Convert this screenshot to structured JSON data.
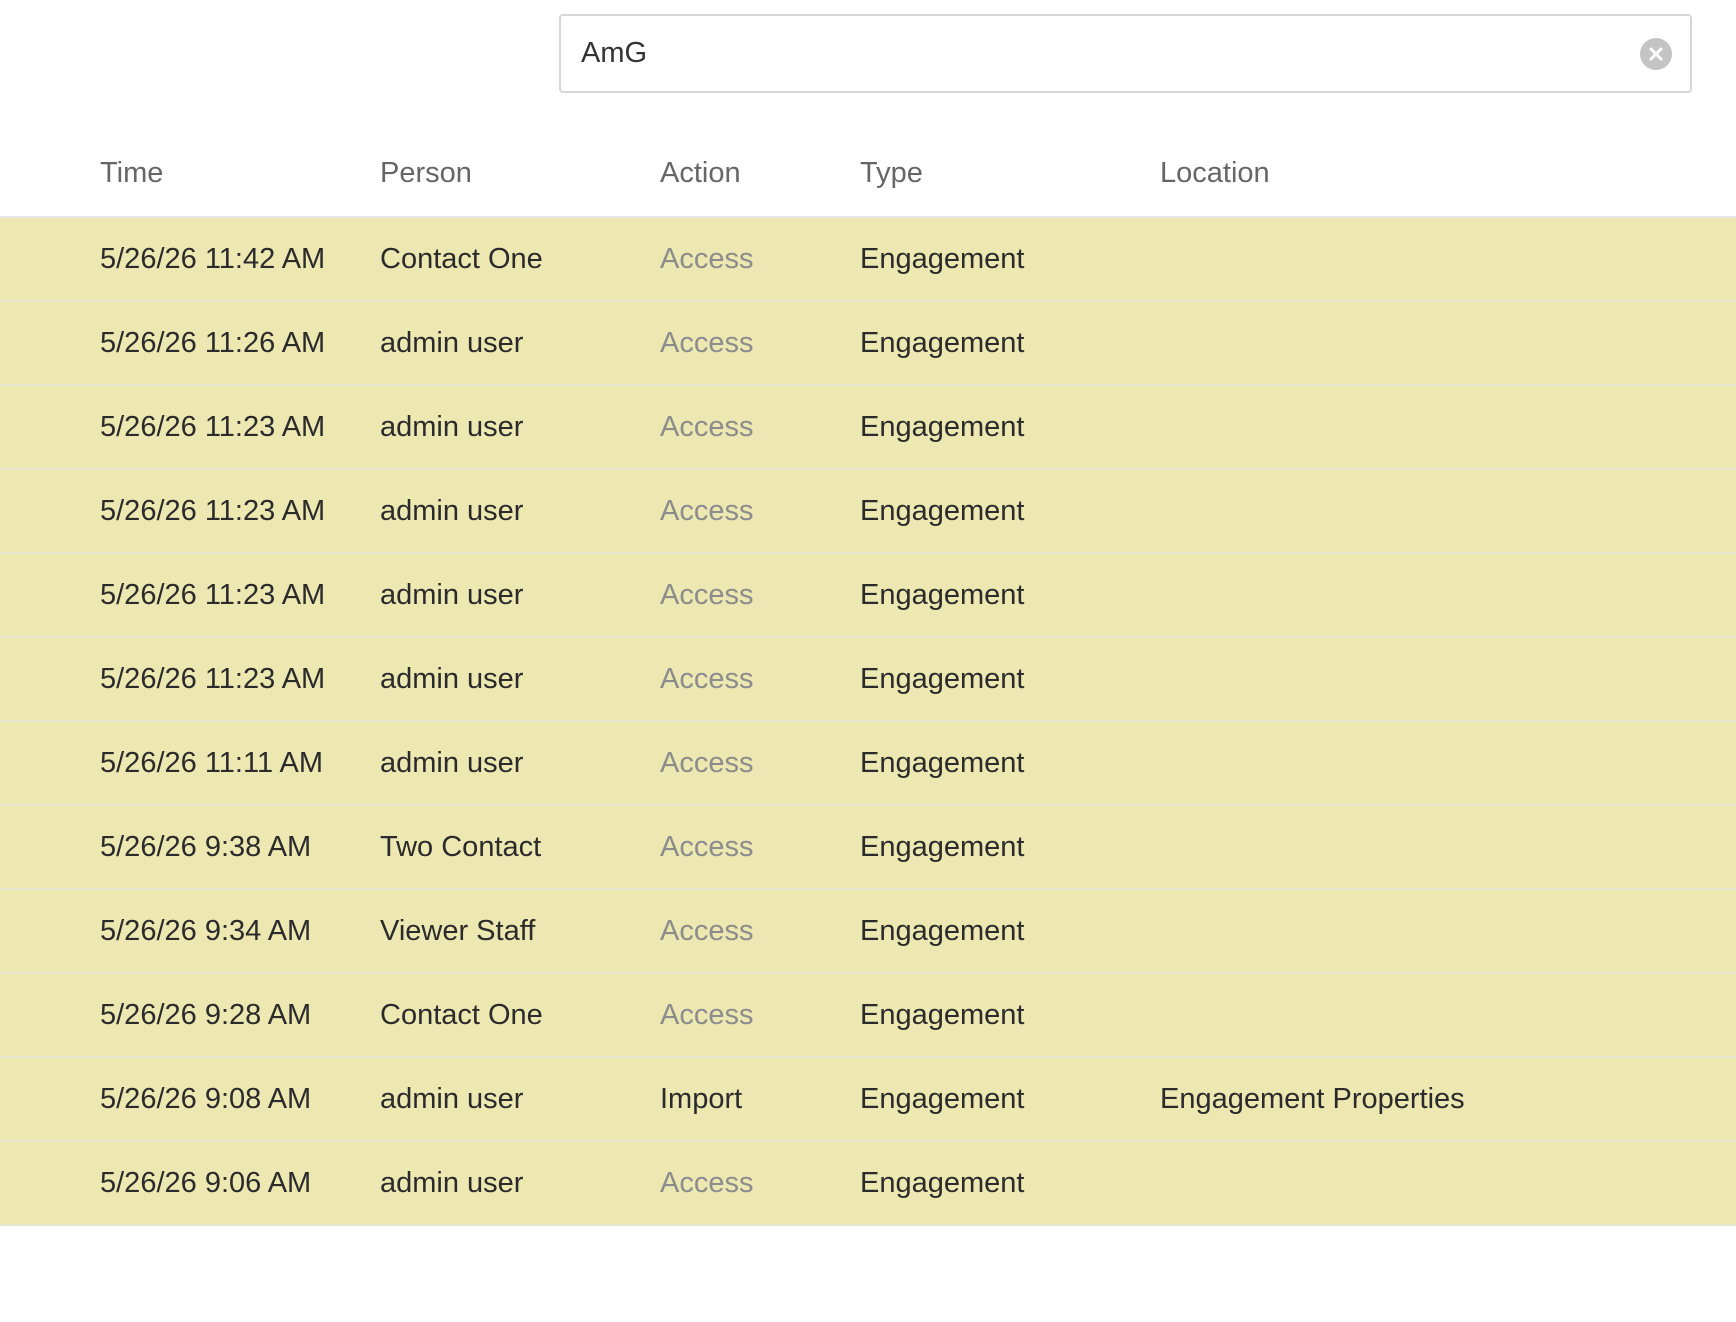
{
  "search": {
    "value": "AmG",
    "placeholder": ""
  },
  "table": {
    "headers": {
      "time": "Time",
      "person": "Person",
      "action": "Action",
      "type": "Type",
      "location": "Location"
    },
    "rows": [
      {
        "time": "5/26/26 11:42 AM",
        "person": "Contact One",
        "action": "Access",
        "type": "Engagement",
        "location": ""
      },
      {
        "time": "5/26/26 11:26 AM",
        "person": "admin user",
        "action": "Access",
        "type": "Engagement",
        "location": ""
      },
      {
        "time": "5/26/26 11:23 AM",
        "person": "admin user",
        "action": "Access",
        "type": "Engagement",
        "location": ""
      },
      {
        "time": "5/26/26 11:23 AM",
        "person": "admin user",
        "action": "Access",
        "type": "Engagement",
        "location": ""
      },
      {
        "time": "5/26/26 11:23 AM",
        "person": "admin user",
        "action": "Access",
        "type": "Engagement",
        "location": ""
      },
      {
        "time": "5/26/26 11:23 AM",
        "person": "admin user",
        "action": "Access",
        "type": "Engagement",
        "location": ""
      },
      {
        "time": "5/26/26 11:11 AM",
        "person": "admin user",
        "action": "Access",
        "type": "Engagement",
        "location": ""
      },
      {
        "time": "5/26/26 9:38 AM",
        "person": "Two Contact",
        "action": "Access",
        "type": "Engagement",
        "location": ""
      },
      {
        "time": "5/26/26 9:34 AM",
        "person": "Viewer Staff",
        "action": "Access",
        "type": "Engagement",
        "location": ""
      },
      {
        "time": "5/26/26 9:28 AM",
        "person": "Contact One",
        "action": "Access",
        "type": "Engagement",
        "location": ""
      },
      {
        "time": "5/26/26 9:08 AM",
        "person": "admin user",
        "action": "Import",
        "type": "Engagement",
        "location": "Engagement Properties"
      },
      {
        "time": "5/26/26 9:06 AM",
        "person": "admin user",
        "action": "Access",
        "type": "Engagement",
        "location": ""
      }
    ]
  },
  "colors": {
    "row_highlight": "#ede7b2",
    "action_access": "#8c8c8c",
    "text": "#2b2b2b",
    "header_text": "#666666"
  },
  "icons": {
    "clear": "close-circle-icon"
  }
}
